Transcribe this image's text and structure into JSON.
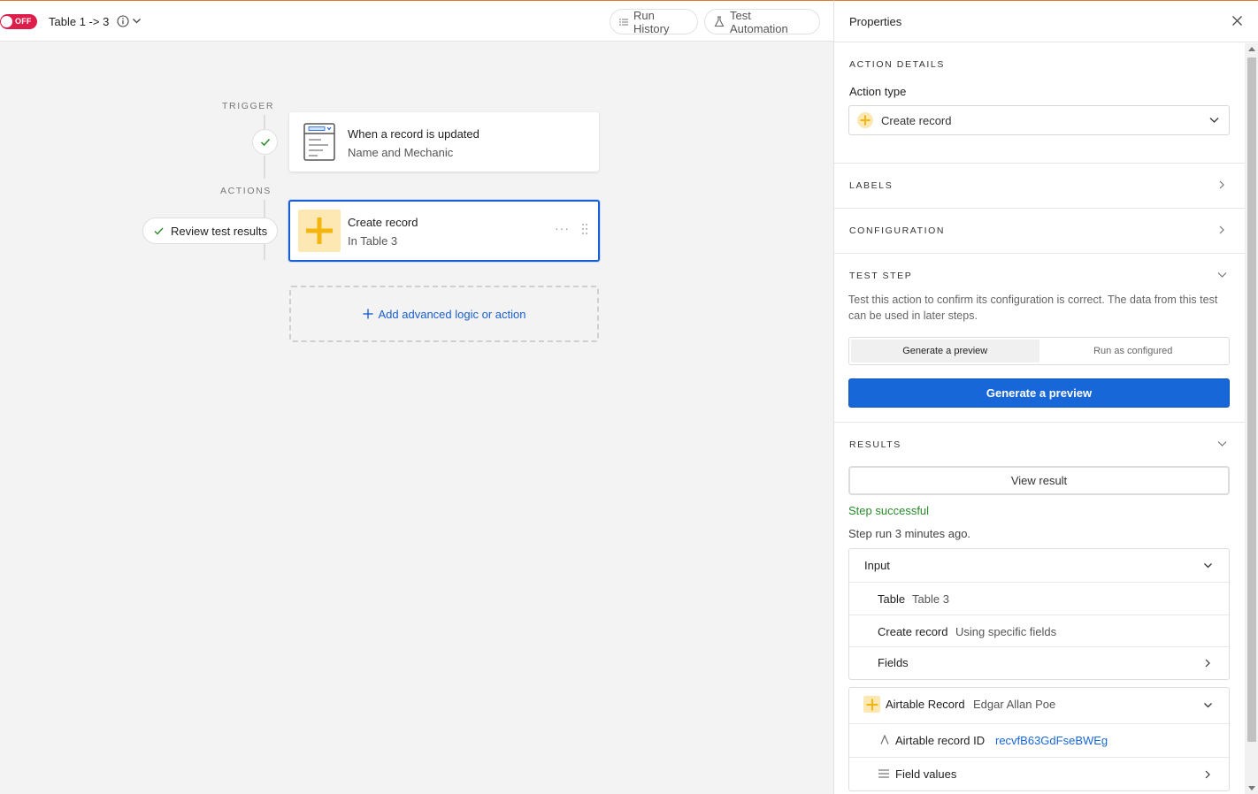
{
  "topbar": {
    "toggle_label": "OFF",
    "title": "Table 1 -> 3",
    "run_history": "Run History",
    "test_automation": "Test Automation"
  },
  "canvas": {
    "trigger_label": "TRIGGER",
    "actions_label": "ACTIONS",
    "review_button": "Review test results",
    "trigger_card": {
      "title": "When a record is updated",
      "subtitle": "Name and Mechanic"
    },
    "action_card": {
      "title": "Create record",
      "subtitle": "In Table 3",
      "more": "···"
    },
    "add_action": "Add advanced logic or action"
  },
  "panel": {
    "title": "Properties",
    "action_details": {
      "heading": "ACTION DETAILS",
      "action_type_label": "Action type",
      "action_type_value": "Create record"
    },
    "labels_heading": "LABELS",
    "configuration_heading": "CONFIGURATION",
    "test_step": {
      "heading": "TEST STEP",
      "description": "Test this action to confirm its configuration is correct. The data from this test can be used in later steps.",
      "segments": [
        "Generate a preview",
        "Run as configured"
      ],
      "active_segment": "Generate a preview",
      "primary_button": "Generate a preview"
    },
    "results": {
      "heading": "RESULTS",
      "view_result": "View result",
      "status": "Step successful",
      "run_time": "Step run 3 minutes ago.",
      "input": {
        "title": "Input",
        "rows": [
          {
            "key": "Table",
            "value": "Table 3"
          },
          {
            "key": "Create record",
            "value": "Using specific fields"
          },
          {
            "key": "Fields",
            "value": ""
          }
        ]
      },
      "record": {
        "title": "Airtable Record",
        "title_value": "Edgar Allan Poe",
        "id_label": "Airtable record ID",
        "id_value": "recvfB63GdFseBWEg",
        "field_values": "Field values"
      }
    }
  },
  "colors": {
    "accent_blue": "#1867d8",
    "toggle_off_red": "#dd1d4a",
    "success_green": "#2a8a2a",
    "create_icon_yellow": "#f4b50e"
  }
}
